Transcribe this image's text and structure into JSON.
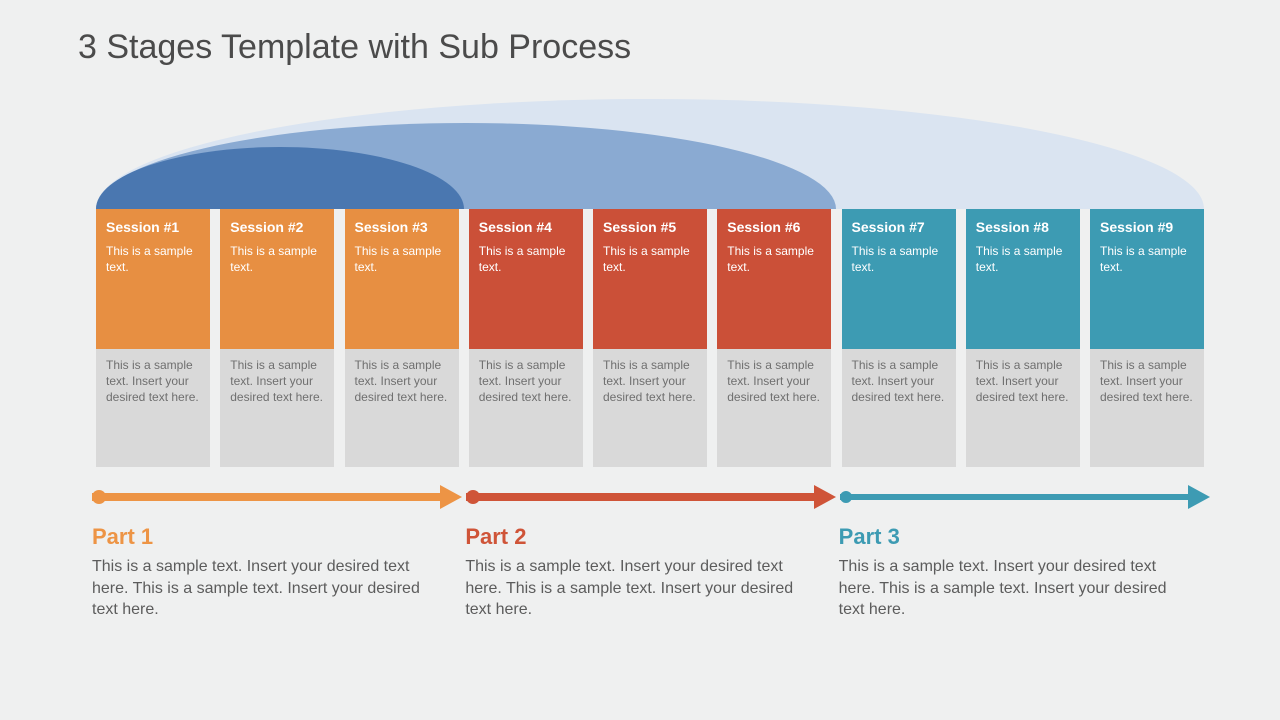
{
  "title": "3 Stages Template with Sub Process",
  "session_upper_text": "This is a sample text.",
  "session_lower_text": "This is a sample text. Insert your desired text here.",
  "sessions": [
    {
      "label": "Session #1",
      "group": "or"
    },
    {
      "label": "Session #2",
      "group": "or"
    },
    {
      "label": "Session #3",
      "group": "or"
    },
    {
      "label": "Session #4",
      "group": "rd"
    },
    {
      "label": "Session #5",
      "group": "rd"
    },
    {
      "label": "Session #6",
      "group": "rd"
    },
    {
      "label": "Session #7",
      "group": "tl"
    },
    {
      "label": "Session #8",
      "group": "tl"
    },
    {
      "label": "Session #9",
      "group": "tl"
    }
  ],
  "parts": [
    {
      "title": "Part 1",
      "group": "or",
      "body": "This is a sample text.  Insert your desired text here. This is a sample text.  Insert your desired text here."
    },
    {
      "title": "Part 2",
      "group": "rd",
      "body": "This is a sample text.  Insert your desired text here. This is a sample text.  Insert your desired text here."
    },
    {
      "title": "Part 3",
      "group": "tl",
      "body": "This is a sample text.  Insert your desired text here. This is a sample text.  Insert your desired text here."
    }
  ],
  "colors": {
    "orange": "#ed9445",
    "red": "#cf5438",
    "teal": "#3d9bb3",
    "arc_outer": "#dae4f1",
    "arc_middle": "#8aaad2",
    "arc_inner": "#4a77b0"
  }
}
